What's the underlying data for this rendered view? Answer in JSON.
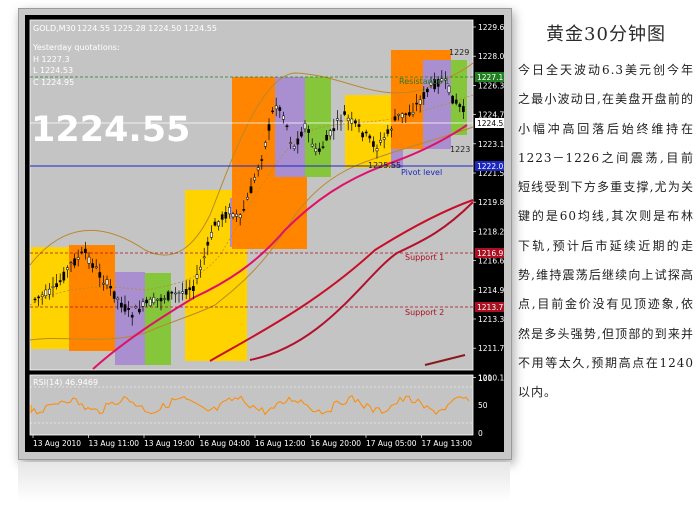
{
  "chart": {
    "symbol": "GOLD,M30",
    "ohlc": "1224.55 1225.28 1224.50 1224.55",
    "info": [
      "Yesterday quotations:",
      "H 1227.3",
      "L 1224.53",
      "C 1224.95"
    ],
    "big_price": "1224.55",
    "lines": {
      "resistance": "Resistance 1",
      "pivot": "Pivot level",
      "support1": "Support 1",
      "support2": "Support 2"
    },
    "price_labels": [
      "1229",
      "1225.55",
      "1223"
    ],
    "axis_ticks": [
      "1229.60",
      "1228.00",
      "1226.35",
      "1224.75",
      "1223.10",
      "1221.50",
      "1219.85",
      "1218.20",
      "1216.60",
      "1214.95",
      "1213.35",
      "1211.70",
      "1210.10"
    ],
    "axis_tags": {
      "resistance": "1227.17",
      "current": "1224.55",
      "pivot": "1222.05",
      "support1": "1216.93",
      "support2": "1213.77"
    },
    "rsi_label": "RSI(14) 46.9469",
    "rsi_ticks": [
      "100",
      "50",
      "0"
    ],
    "dates": [
      "13 Aug 2010",
      "13 Aug 11:00",
      "13 Aug 19:00",
      "16 Aug 04:00",
      "16 Aug 12:00",
      "16 Aug 20:00",
      "17 Aug 05:00",
      "17 Aug 13:00"
    ]
  },
  "side": {
    "title": "黄金30分钟图",
    "body": "今日全天波动6.3美元创今年之最小波动日,在美盘开盘前的小幅冲高回落后始终维持在1223－1226之间震荡,目前短线受到下方多重支撑,尤为关键的是60均线,其次则是布林下轨,预计后市延续近期的走势,维持震荡后继续向上试探高点,目前金价没有见顶迹象,依然是多头强势,但顶部的到来并不用等太久,预期高点在1240以内。"
  },
  "colors": {
    "background": "#000000",
    "panel": "#c4c4c4",
    "orange": "#ff8400",
    "yellow": "#ffd300",
    "purple": "#a98ed0",
    "green": "#86c63a",
    "ma_pink": "#e0116a",
    "ma_red": "#c80f28",
    "bollinger": "#b8892c",
    "pivot_blue": "#1c27c0",
    "rsi_orange": "#ff8a00"
  }
}
